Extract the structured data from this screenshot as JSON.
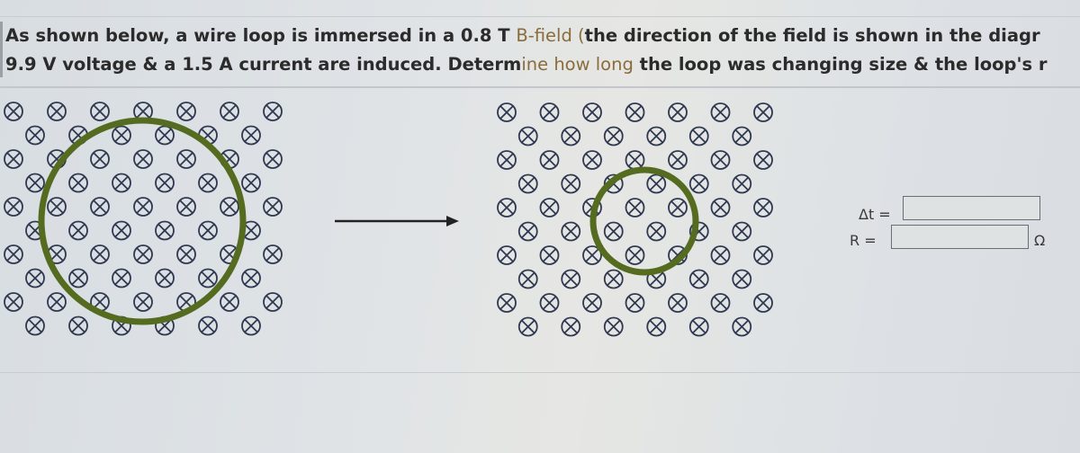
{
  "question": {
    "line1_pre": "As shown below, a wire loop is immersed in a 0.8 T ",
    "line1_hl": "B-field (",
    "line1_post": "the direction of the field is shown in the diagr",
    "line2_pre": "9.9 V voltage & a 1.5 A current are induced. Determ",
    "line2_hl": "ine how long",
    "line2_post": " the loop was changing size & the loop's r"
  },
  "diagram": {
    "field_symbol": "⊗",
    "field_direction": "into-page",
    "loop_color": "#556b1f",
    "field_color": "#2f3850",
    "arrow_color": "#222222",
    "rows": 10,
    "initial_state": "large-loop",
    "final_state": "small-loop"
  },
  "answers": [
    {
      "label": "Δt =",
      "value": "",
      "unit": ""
    },
    {
      "label": "R =",
      "value": "",
      "unit": "Ω"
    }
  ]
}
